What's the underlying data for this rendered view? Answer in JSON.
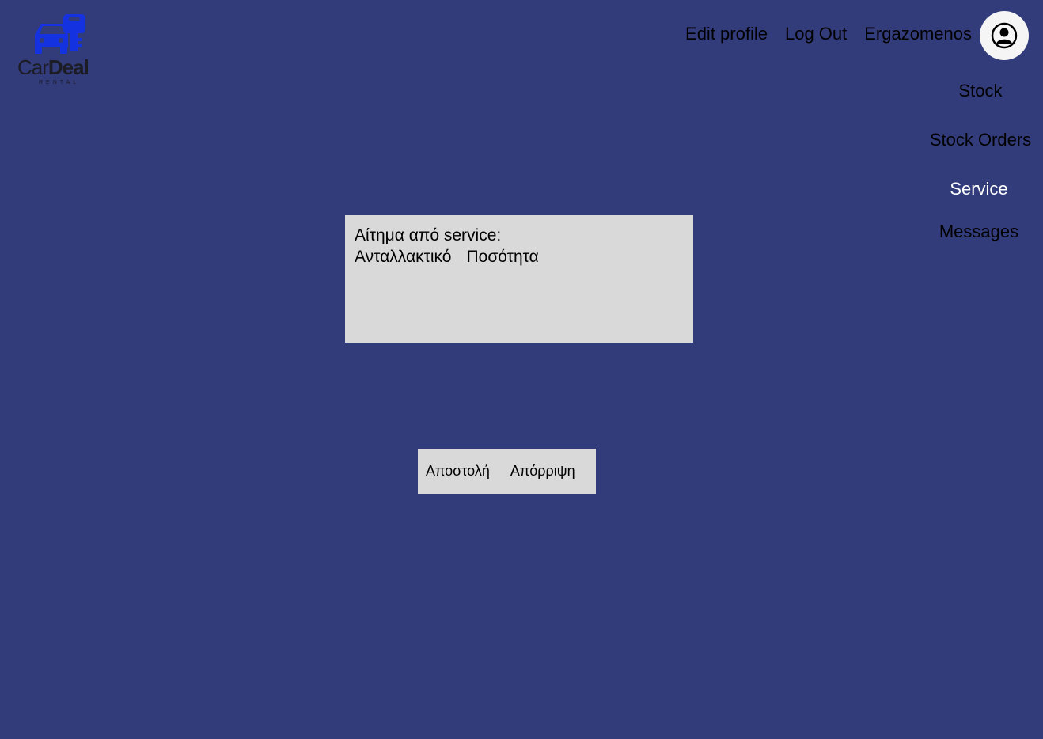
{
  "brand": {
    "name_part1": "Car",
    "name_part2": "Deal",
    "tagline": "RENTAL",
    "logo_color": "#1432e0"
  },
  "topnav": {
    "edit_profile": "Edit profile",
    "log_out": "Log Out",
    "username": "Ergazomenos",
    "avatar_icon": "user-circle-icon"
  },
  "sidemenu": {
    "items": [
      {
        "label": "Stock"
      },
      {
        "label": "Stock Orders"
      },
      {
        "label": "Service",
        "active": true
      },
      {
        "label": "Messages"
      }
    ]
  },
  "request": {
    "title": "Αίτημα από service:",
    "col_part": "Ανταλλακτικό",
    "col_quantity": "Ποσότητα"
  },
  "actions": {
    "send": "Αποστολή",
    "reject": "Απόρριψη"
  },
  "colors": {
    "background": "#323c7b",
    "panel": "#d9d9d9",
    "active_menu": "#ffffff"
  }
}
